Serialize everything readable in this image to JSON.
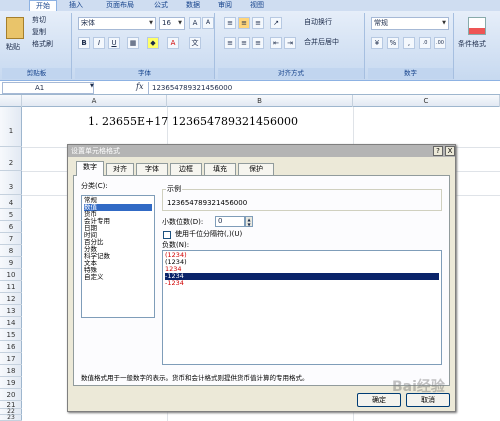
{
  "ribbon_tabs": [
    "开始",
    "插入",
    "页面布局",
    "公式",
    "数据",
    "审阅",
    "视图"
  ],
  "clipboard": {
    "paste": "粘贴",
    "cut": "剪切",
    "copy": "复制",
    "format_painter": "格式刷",
    "group": "剪贴板"
  },
  "font": {
    "name": "宋体",
    "size": "16",
    "bold": "B",
    "italic": "I",
    "underline": "U",
    "group": "字体"
  },
  "alignment": {
    "wrap": "自动换行",
    "merge": "合并后居中",
    "group": "对齐方式"
  },
  "number": {
    "format": "常规",
    "percent": "%",
    "comma": ",",
    "group": "数字"
  },
  "styles": {
    "conditional": "条件格式"
  },
  "formula_bar": {
    "name_box": "A1",
    "fx": "fx",
    "value": "123654789321456000"
  },
  "columns": [
    "A",
    "B",
    "C"
  ],
  "rows": [
    "1",
    "2",
    "3",
    "4",
    "5",
    "6",
    "7",
    "8",
    "9",
    "10",
    "11",
    "12",
    "13",
    "14",
    "15",
    "16",
    "17",
    "18",
    "19",
    "20",
    "21",
    "22",
    "23"
  ],
  "cells": {
    "a1": "1. 23655E+17",
    "b1": "123654789321456000"
  },
  "dialog": {
    "title": "设置单元格格式",
    "help": "?",
    "close": "X",
    "tabs": [
      "数字",
      "对齐",
      "字体",
      "边框",
      "填充",
      "保护"
    ],
    "category_label": "分类(C):",
    "categories": [
      "常规",
      "数值",
      "货币",
      "会计专用",
      "日期",
      "时间",
      "百分比",
      "分数",
      "科学记数",
      "文本",
      "特殊",
      "自定义"
    ],
    "sample_label": "示例",
    "sample_value": "123654789321456000",
    "decimals_label": "小数位数(D):",
    "decimals_value": "0",
    "thousands_label": "使用千位分隔符(,)(U)",
    "negative_label": "负数(N):",
    "negatives": [
      "(1234)",
      "(1234)",
      "1234",
      "-1234",
      "-1234"
    ],
    "description": "数值格式用于一般数字的表示。货币和会计格式则提供货币值计算的专用格式。",
    "ok": "确定",
    "cancel": "取消"
  },
  "watermark": "Bai经验",
  "colors": {
    "accent": "#15428b",
    "selection": "#316ac5",
    "negative_red": "#d00000"
  }
}
